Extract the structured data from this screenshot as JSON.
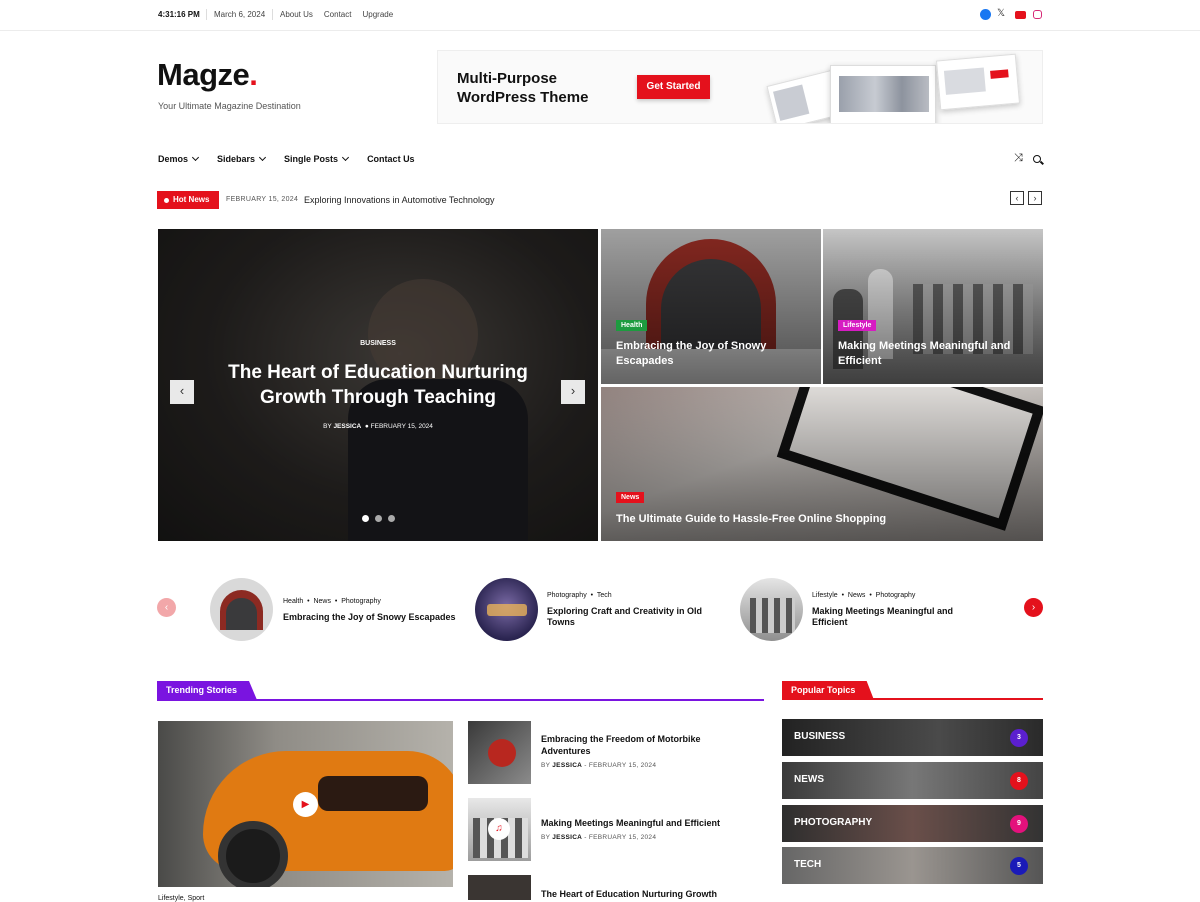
{
  "topbar": {
    "time": "4:31:16 PM",
    "date": "March 6, 2024",
    "links": [
      "About Us",
      "Contact",
      "Upgrade"
    ],
    "social_icons": [
      "facebook-icon",
      "x-icon",
      "youtube-icon",
      "instagram-icon"
    ]
  },
  "header": {
    "logo_text": "Magze",
    "logo_dot": ".",
    "tagline": "Your Ultimate Magazine Destination",
    "banner": {
      "title_line1": "Multi-Purpose",
      "title_line2": "WordPress Theme",
      "button": "Get Started"
    }
  },
  "nav": {
    "items": [
      "Demos",
      "Sidebars",
      "Single Posts",
      "Contact Us"
    ],
    "icons": [
      "shuffle-icon",
      "search-icon"
    ]
  },
  "ticker": {
    "label": "Hot News",
    "date": "FEBRUARY 15, 2024",
    "headline": "Exploring Innovations in Automotive Technology"
  },
  "hero": {
    "main": {
      "category": "BUSINESS",
      "title": "The Heart of Education Nurturing Growth Through Teaching",
      "by": "BY",
      "author": "JESSICA",
      "date": "FEBRUARY 15, 2024"
    },
    "tiles": [
      {
        "category": "Health",
        "title": "Embracing the Joy of Snowy Escapades"
      },
      {
        "category": "Lifestyle",
        "title": "Making Meetings Meaningful and Efficient"
      },
      {
        "category": "News",
        "title": "The Ultimate Guide to Hassle-Free Online Shopping"
      }
    ]
  },
  "carousel": [
    {
      "tags": [
        "Health",
        "News",
        "Photography"
      ],
      "title": "Embracing the Joy of Snowy Escapades"
    },
    {
      "tags": [
        "Photography",
        "Tech"
      ],
      "title": "Exploring Craft and Creativity in Old Towns"
    },
    {
      "tags": [
        "Lifestyle",
        "News",
        "Photography"
      ],
      "title": "Making Meetings Meaningful and Efficient"
    }
  ],
  "trending": {
    "heading": "Trending Stories",
    "featured_category": "Lifestyle, Sport",
    "list": [
      {
        "title": "Embracing the Freedom of Motorbike Adventures",
        "by": "BY",
        "author": "JESSICA",
        "date": "FEBRUARY 15, 2024"
      },
      {
        "title": "Making Meetings Meaningful and Efficient",
        "by": "BY",
        "author": "JESSICA",
        "date": "FEBRUARY 15, 2024"
      },
      {
        "title": "The Heart of Education Nurturing Growth",
        "by": "",
        "author": "",
        "date": ""
      }
    ]
  },
  "popular": {
    "heading": "Popular Topics",
    "topics": [
      {
        "label": "BUSINESS",
        "count": "3",
        "color": "#5b1fcf"
      },
      {
        "label": "NEWS",
        "count": "8",
        "color": "#e4111c"
      },
      {
        "label": "PHOTOGRAPHY",
        "count": "9",
        "color": "#e4117c"
      },
      {
        "label": "TECH",
        "count": "5",
        "color": "#1a1ab8"
      }
    ]
  },
  "colors": {
    "accent": "#e4111c",
    "trending": "#7a14e0",
    "health": "#1d9b3f",
    "lifestyle": "#d61cc2",
    "news": "#e4111c"
  }
}
